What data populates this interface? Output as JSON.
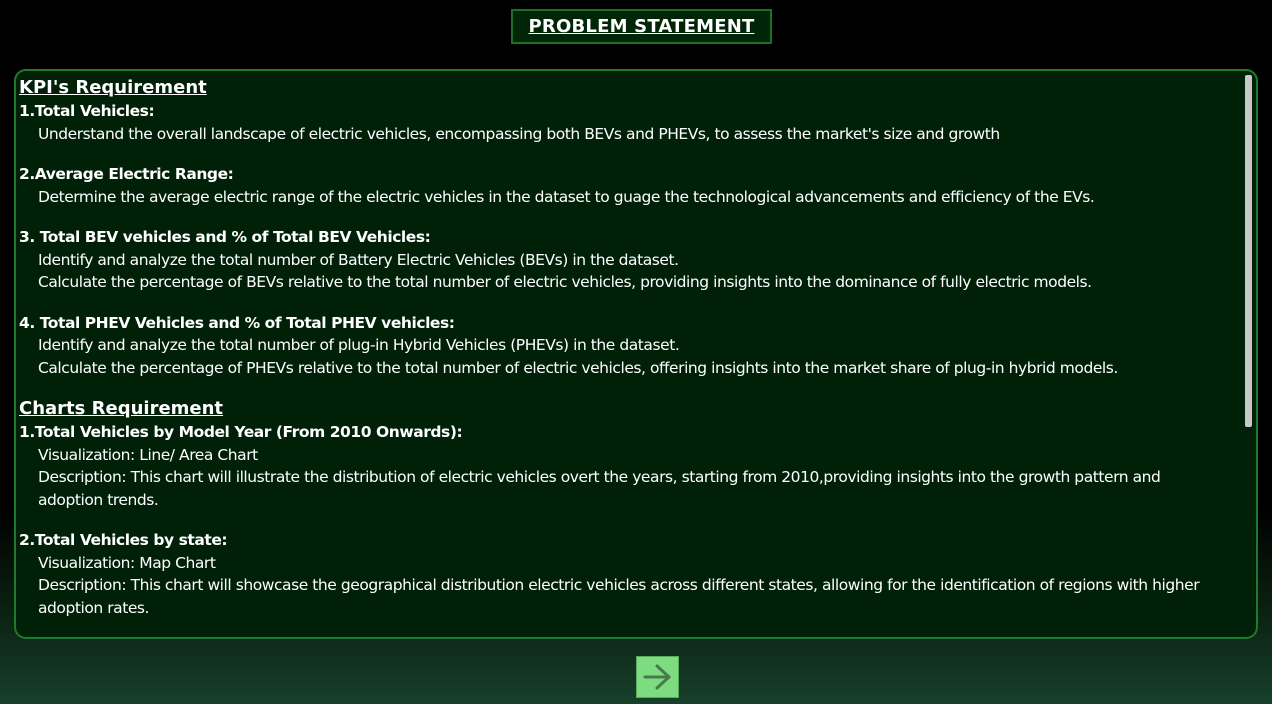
{
  "header": {
    "title": "PROBLEM STATEMENT"
  },
  "kpi_section": {
    "heading": "KPI's Requirement",
    "items": [
      {
        "title": "1.Total Vehicles:",
        "lines": [
          "Understand the overall landscape of electric vehicles, encompassing both BEVs and PHEVs, to assess the market's size and growth"
        ]
      },
      {
        "title": "2.Average Electric Range:",
        "lines": [
          "Determine the average electric range of the electric vehicles in the dataset to guage the technological advancements and efficiency of the EVs."
        ]
      },
      {
        "title": "3. Total BEV vehicles and % of Total BEV Vehicles:",
        "lines": [
          "Identify and analyze the total number of Battery Electric Vehicles (BEVs) in the dataset.",
          "Calculate the percentage of BEVs relative to the total number of electric vehicles, providing insights into the dominance of fully electric models."
        ]
      },
      {
        "title": "4. Total PHEV Vehicles and % of Total PHEV vehicles:",
        "lines": [
          "Identify and analyze the total number of plug-in Hybrid Vehicles (PHEVs) in the dataset.",
          "Calculate the percentage of PHEVs relative to the total number of electric vehicles, offering insights into the market share of plug-in hybrid models."
        ]
      }
    ]
  },
  "charts_section": {
    "heading": "Charts Requirement",
    "items": [
      {
        "title": "1.Total Vehicles by Model Year (From 2010 Onwards):",
        "lines": [
          "Visualization: Line/ Area Chart",
          "Description: This chart will illustrate the distribution of electric vehicles overt the years, starting from 2010,providing insights into the growth pattern and adoption trends."
        ]
      },
      {
        "title": "2.Total Vehicles by state:",
        "lines": [
          "Visualization: Map Chart",
          "Description: This chart will showcase the geographical distribution  electric vehicles across different states, allowing for the identification of regions with higher adoption rates."
        ]
      }
    ]
  },
  "footer": {
    "next_button_icon": "arrow-right-icon"
  },
  "colors": {
    "page_background": "#000000",
    "panel_background": "#002108",
    "panel_border": "#1e7a2e",
    "title_box_background": "#002607",
    "next_button_background": "#7ddc7f",
    "arrow_color": "#4a7a4c",
    "text": "#ffffff"
  }
}
